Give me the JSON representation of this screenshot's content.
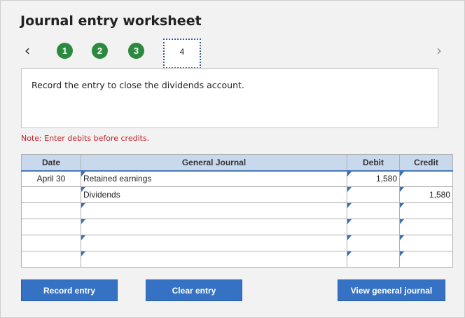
{
  "header": {
    "title": "Journal entry worksheet"
  },
  "navigation": {
    "prev_icon": "chevron-left-icon",
    "next_icon": "chevron-right-icon",
    "steps": [
      "1",
      "2",
      "3"
    ],
    "current_step": "4"
  },
  "instruction": {
    "text": "Record the entry to close the dividends account."
  },
  "note": "Note: Enter debits before credits.",
  "table": {
    "headers": {
      "date": "Date",
      "general_journal": "General Journal",
      "debit": "Debit",
      "credit": "Credit"
    },
    "rows": [
      {
        "date": "April 30",
        "account": "Retained earnings",
        "debit": "1,580",
        "credit": ""
      },
      {
        "date": "",
        "account": "Dividends",
        "debit": "",
        "credit": "1,580"
      },
      {
        "date": "",
        "account": "",
        "debit": "",
        "credit": ""
      },
      {
        "date": "",
        "account": "",
        "debit": "",
        "credit": ""
      },
      {
        "date": "",
        "account": "",
        "debit": "",
        "credit": ""
      },
      {
        "date": "",
        "account": "",
        "debit": "",
        "credit": ""
      }
    ]
  },
  "buttons": {
    "record_entry": "Record entry",
    "clear_entry": "Clear entry",
    "view_general_journal": "View general journal"
  },
  "colors": {
    "accent": "#3572c4",
    "step_complete": "#2b8a3e",
    "note": "#c0202a",
    "table_header": "#c8d9ee"
  }
}
